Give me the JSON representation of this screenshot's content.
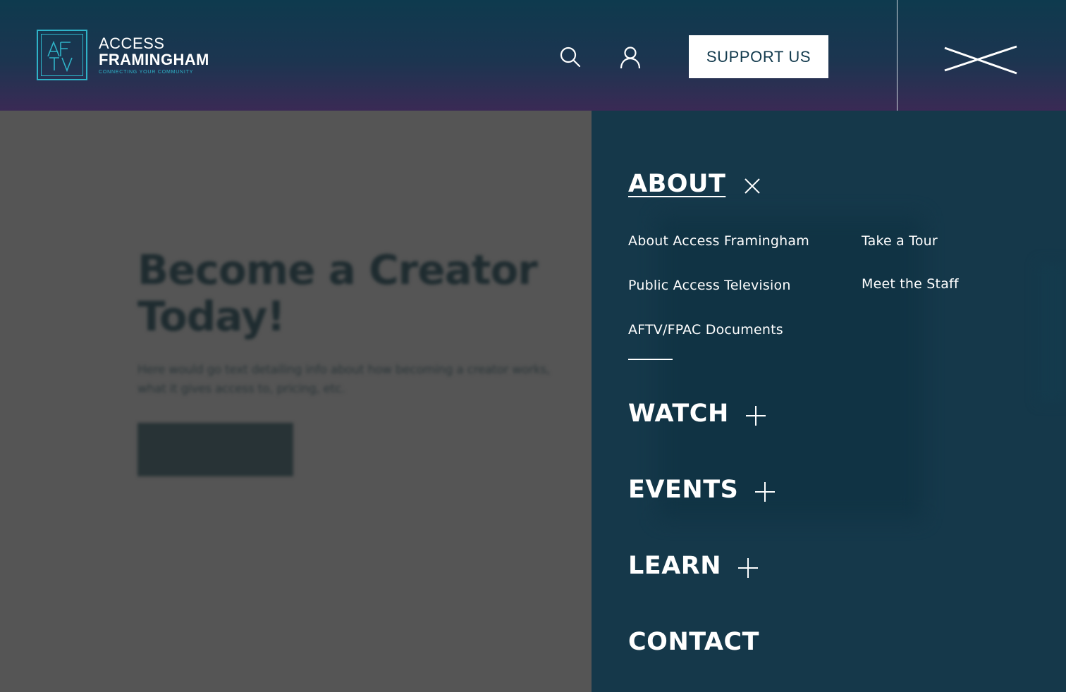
{
  "header": {
    "logo": {
      "line1": "ACCESS",
      "line2": "FRAMINGHAM",
      "tagline": "CONNECTING YOUR COMMUNITY",
      "mark": "AFTV"
    },
    "support_label": "SUPPORT US",
    "icons": [
      "search-icon",
      "user-icon",
      "close-icon"
    ]
  },
  "background": {
    "title_line1": "Become a Creator",
    "title_line2": "Today!",
    "text_line1": "Here would go text detailing info about how becoming  a creator works,",
    "text_line2": "what it gives access to, pricing, etc."
  },
  "menu": {
    "about": {
      "label": "ABOUT",
      "expanded": true,
      "links_col1": [
        "About Access Framingham",
        "Public Access Television",
        "AFTV/FPAC Documents"
      ],
      "links_col2": [
        "Take a Tour",
        "Meet the Staff"
      ]
    },
    "watch": {
      "label": "WATCH",
      "expanded": false
    },
    "events": {
      "label": "EVENTS",
      "expanded": false
    },
    "learn": {
      "label": "LEARN",
      "expanded": false
    },
    "contact": {
      "label": "CONTACT"
    }
  },
  "colors": {
    "accent": "#2fb3c8",
    "panel": "#15384a",
    "overlay": "#555555"
  }
}
